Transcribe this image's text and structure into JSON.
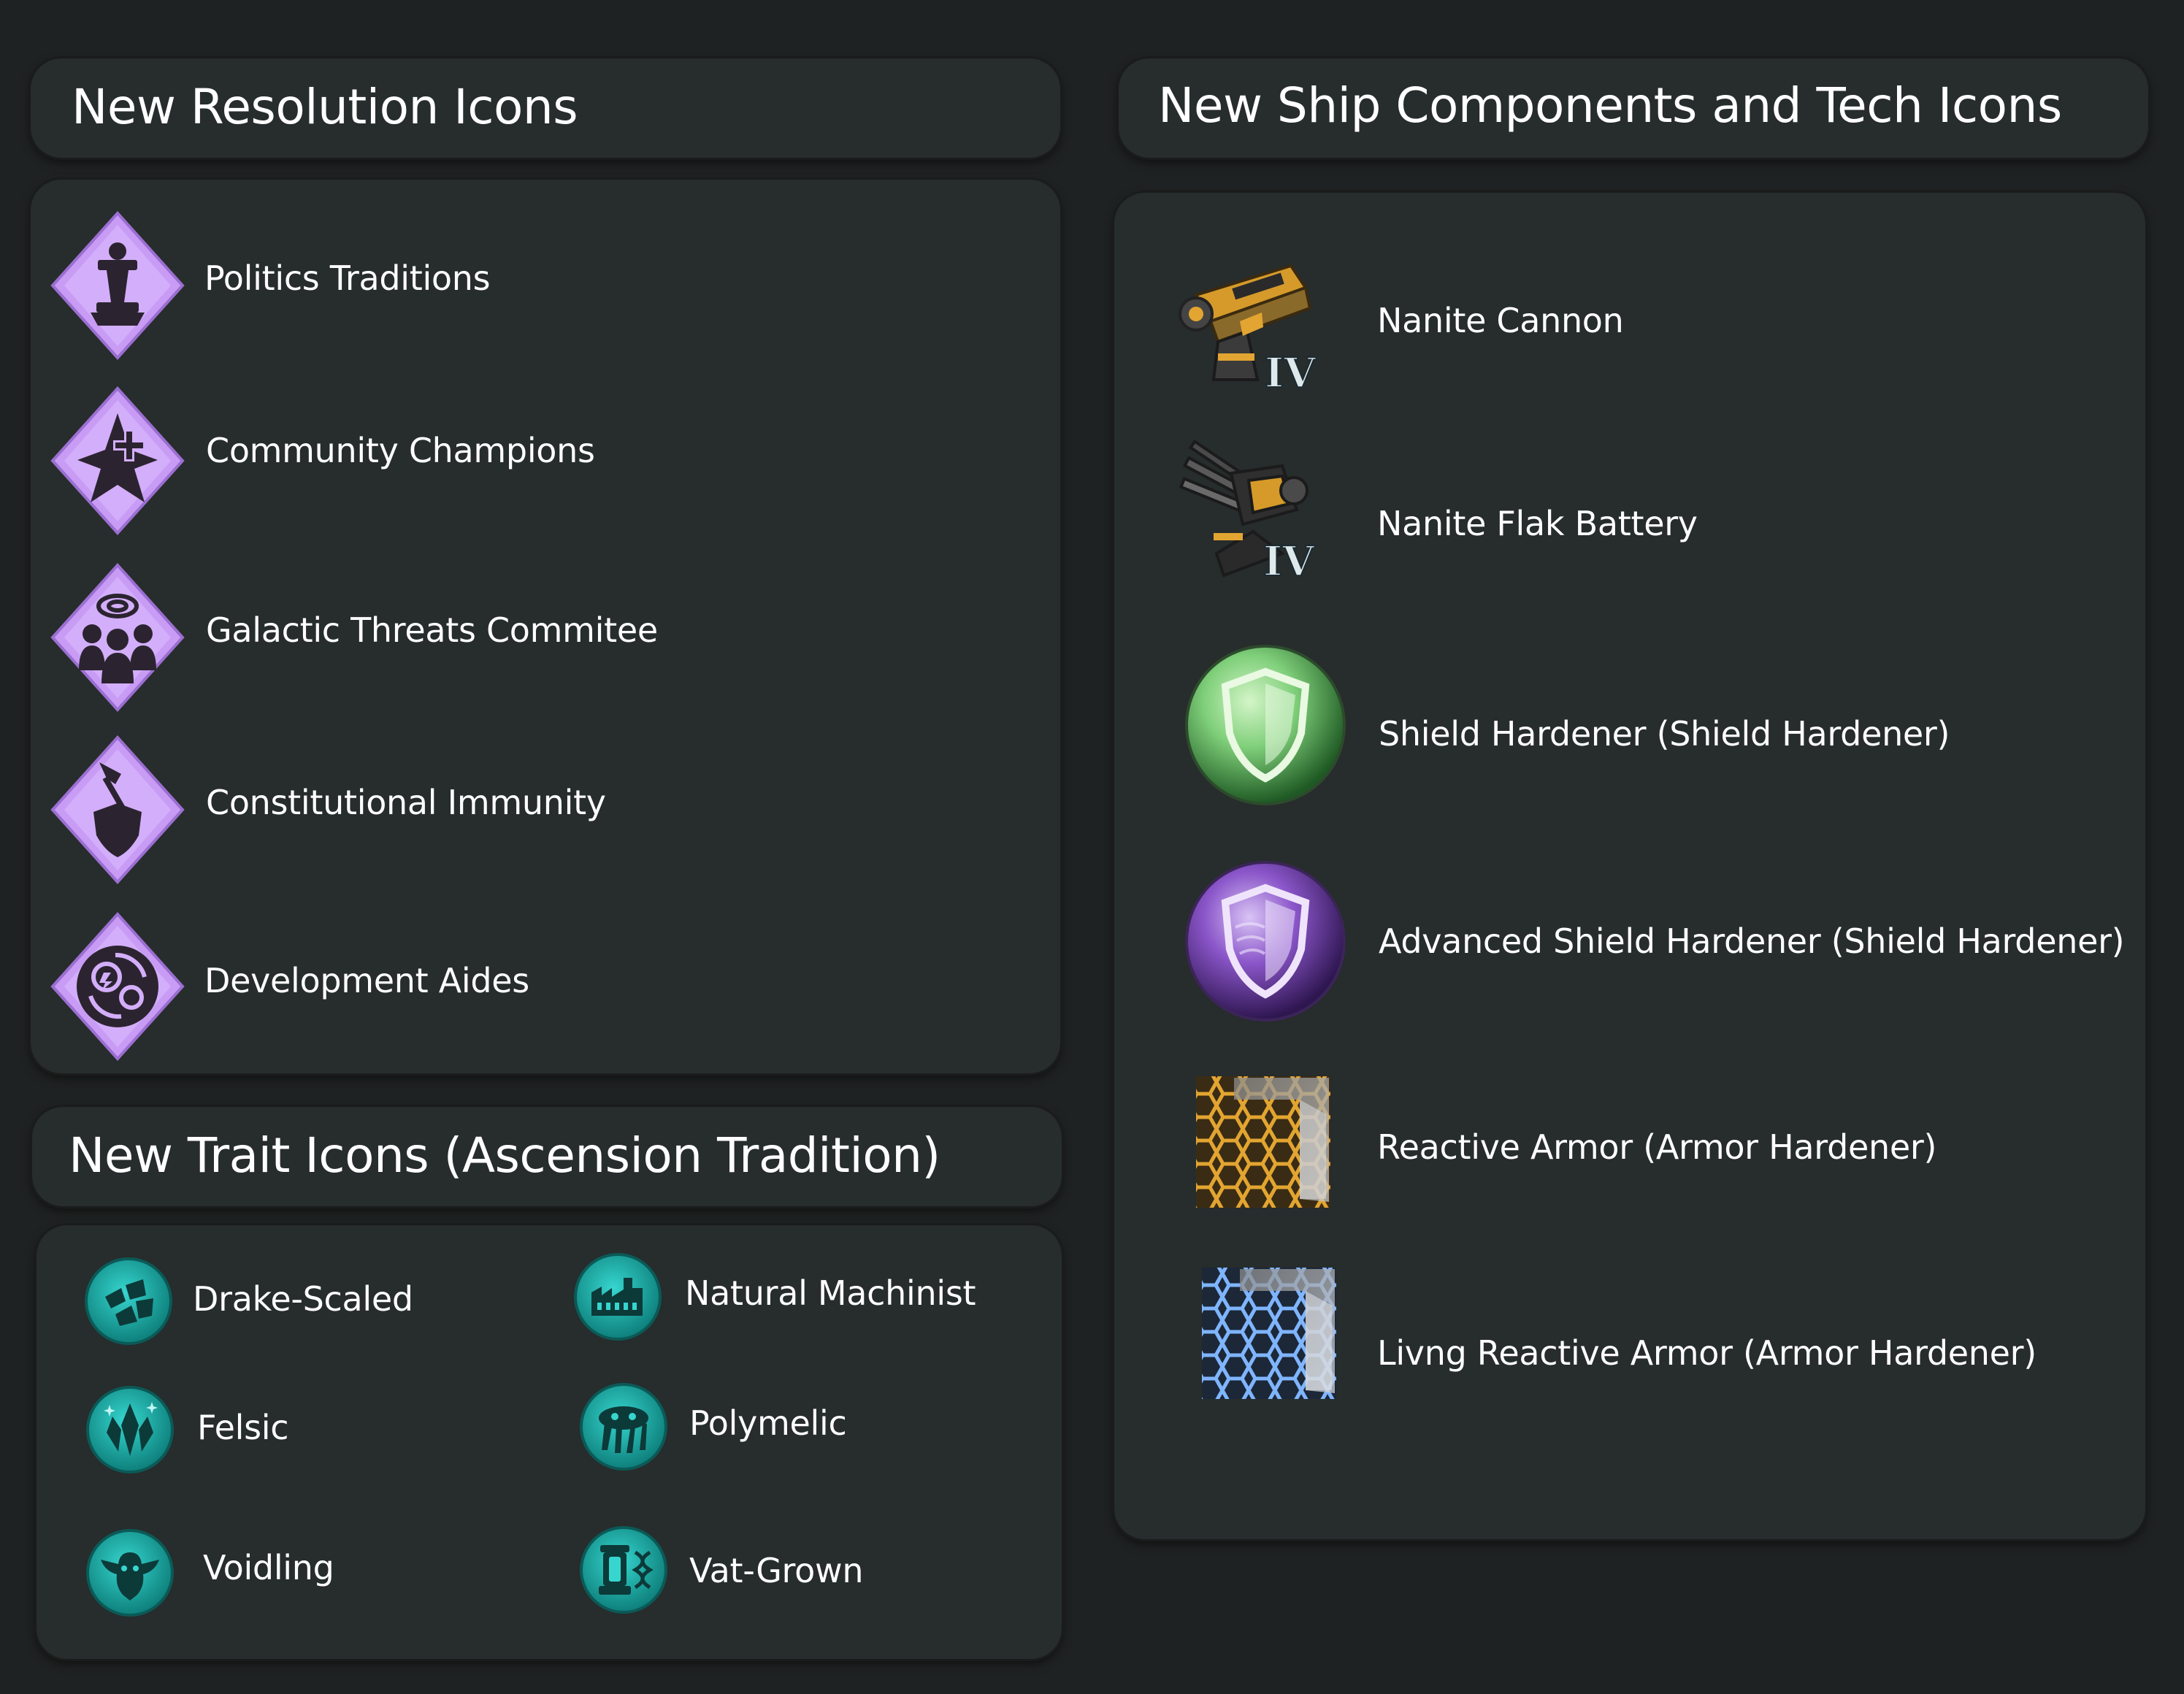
{
  "sections": {
    "resolution": {
      "title": "New Resolution Icons",
      "items": [
        {
          "label": "Politics Traditions",
          "icon": "politics-traditions-icon"
        },
        {
          "label": "Community Champions",
          "icon": "community-champions-icon"
        },
        {
          "label": "Galactic Threats Commitee",
          "icon": "galactic-threats-icon"
        },
        {
          "label": "Constitutional Immunity",
          "icon": "constitutional-immunity-icon"
        },
        {
          "label": "Development Aides",
          "icon": "development-aides-icon"
        }
      ]
    },
    "traits": {
      "title": "New Trait Icons (Ascension Tradition)",
      "items": [
        {
          "label": "Drake-Scaled",
          "icon": "drake-scaled-icon"
        },
        {
          "label": "Natural Machinist",
          "icon": "natural-machinist-icon"
        },
        {
          "label": "Felsic",
          "icon": "felsic-icon"
        },
        {
          "label": "Polymelic",
          "icon": "polymelic-icon"
        },
        {
          "label": "Voidling",
          "icon": "voidling-icon"
        },
        {
          "label": "Vat-Grown",
          "icon": "vat-grown-icon"
        }
      ]
    },
    "ship": {
      "title": "New Ship Components and Tech Icons",
      "items": [
        {
          "label": "Nanite Cannon",
          "icon": "nanite-cannon-icon",
          "tier": "IV"
        },
        {
          "label": "Nanite Flak Battery",
          "icon": "nanite-flak-battery-icon",
          "tier": "IV"
        },
        {
          "label": "Shield Hardener (Shield Hardener)",
          "icon": "shield-hardener-icon"
        },
        {
          "label": "Advanced Shield Hardener (Shield Hardener)",
          "icon": "advanced-shield-hardener-icon"
        },
        {
          "label": "Reactive Armor (Armor Hardener)",
          "icon": "reactive-armor-icon"
        },
        {
          "label": "Livng Reactive Armor (Armor Hardener)",
          "icon": "living-reactive-armor-icon"
        }
      ]
    }
  },
  "colors": {
    "background": "#1f2222",
    "panel": "#272c2c",
    "resolution_purple": "#c89cf5",
    "trait_teal": "#1fb7b2",
    "shield_green": "#7fcf7a",
    "shield_purple": "#8a55c9",
    "gold": "#e3a531"
  }
}
